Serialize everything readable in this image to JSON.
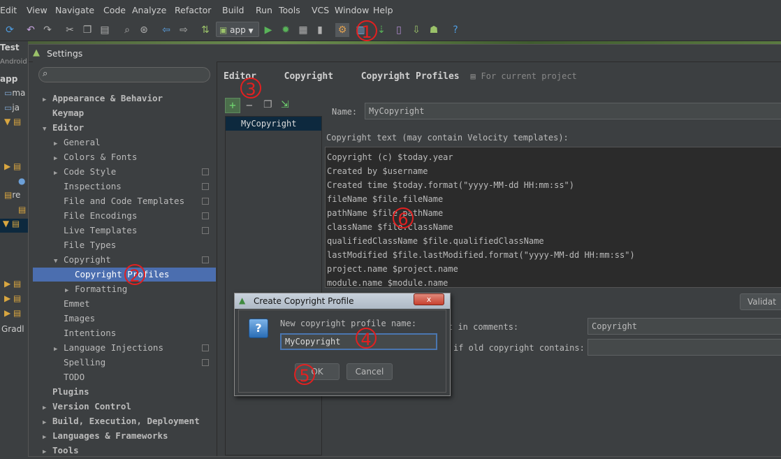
{
  "menubar": {
    "items": [
      "Edit",
      "View",
      "Navigate",
      "Code",
      "Analyze",
      "Refactor",
      "Build",
      "Run",
      "Tools",
      "VCS",
      "Window",
      "Help"
    ]
  },
  "toolbar": {
    "run_config": "app",
    "icons": [
      "sync-icon",
      "undo-icon",
      "redo-icon",
      "cut-icon",
      "copy-icon",
      "paste-icon",
      "find-icon",
      "replace-icon",
      "back-icon",
      "forward-icon",
      "build-icon",
      "android-icon",
      "run-icon",
      "debug-icon",
      "coverage-icon",
      "stop-icon",
      "settings-icon",
      "project-structure-icon",
      "sync-gradle-icon",
      "avd-icon",
      "sdk-icon",
      "android-monitor-icon",
      "help-icon"
    ]
  },
  "ide_left": {
    "tab": "Test",
    "rows": [
      "Android",
      "app",
      "ma",
      "ja",
      "re",
      "Gradl"
    ]
  },
  "settings": {
    "title": "Settings",
    "tree": [
      {
        "label": "Appearance & Behavior",
        "bold": true,
        "arrow": "right",
        "indent": 0
      },
      {
        "label": "Keymap",
        "bold": true,
        "arrow": "",
        "indent": 0
      },
      {
        "label": "Editor",
        "bold": true,
        "arrow": "down",
        "indent": 0
      },
      {
        "label": "General",
        "arrow": "right",
        "indent": 1
      },
      {
        "label": "Colors & Fonts",
        "arrow": "right",
        "indent": 1
      },
      {
        "label": "Code Style",
        "arrow": "right",
        "indent": 1,
        "copy": true
      },
      {
        "label": "Inspections",
        "arrow": "",
        "indent": 1,
        "copy": true
      },
      {
        "label": "File and Code Templates",
        "arrow": "",
        "indent": 1,
        "copy": true
      },
      {
        "label": "File Encodings",
        "arrow": "",
        "indent": 1,
        "copy": true
      },
      {
        "label": "Live Templates",
        "arrow": "",
        "indent": 1,
        "copy": true
      },
      {
        "label": "File Types",
        "arrow": "",
        "indent": 1
      },
      {
        "label": "Copyright",
        "arrow": "down",
        "indent": 1,
        "copy": true
      },
      {
        "label": "Copyright Profiles",
        "arrow": "",
        "indent": 2,
        "selected": true
      },
      {
        "label": "Formatting",
        "arrow": "right",
        "indent": 2
      },
      {
        "label": "Emmet",
        "arrow": "",
        "indent": 1
      },
      {
        "label": "Images",
        "arrow": "",
        "indent": 1
      },
      {
        "label": "Intentions",
        "arrow": "",
        "indent": 1
      },
      {
        "label": "Language Injections",
        "arrow": "right",
        "indent": 1,
        "copy": true
      },
      {
        "label": "Spelling",
        "arrow": "",
        "indent": 1,
        "copy": true
      },
      {
        "label": "TODO",
        "arrow": "",
        "indent": 1
      },
      {
        "label": "Plugins",
        "bold": true,
        "arrow": "",
        "indent": 0
      },
      {
        "label": "Version Control",
        "bold": true,
        "arrow": "right",
        "indent": 0
      },
      {
        "label": "Build, Execution, Deployment",
        "bold": true,
        "arrow": "right",
        "indent": 0
      },
      {
        "label": "Languages & Frameworks",
        "bold": true,
        "arrow": "right",
        "indent": 0
      },
      {
        "label": "Tools",
        "bold": true,
        "arrow": "right",
        "indent": 0
      }
    ],
    "breadcrumb": [
      "Editor",
      "Copyright",
      "Copyright Profiles"
    ],
    "for_current_project": "For current project",
    "profiles": [
      "MyCopyright"
    ],
    "name_label": "Name:",
    "name_value": "MyCopyright",
    "copyright_text_label": "Copyright text (may contain Velocity templates):",
    "copyright_lines": [
      "Copyright (c) $today.year",
      "Created by $username",
      "Created time $today.format(\"yyyy-MM-dd HH:mm:ss\")",
      "fileName $file.fileName",
      "pathName $file.pathName",
      "className $file.className",
      "qualifiedClassName $file.qualifiedClassName",
      "lastModified $file.lastModified.format(\"yyyy-MM-dd HH:mm:ss\")",
      "project.name $project.name",
      "module.name $module.name"
    ],
    "validate_button": "Validat",
    "keyword_label": "t in comments:",
    "keyword_value": "Copyright",
    "replace_label": "if old copyright contains:",
    "replace_value": ""
  },
  "modal": {
    "title": "Create Copyright Profile",
    "close": "x",
    "prompt": "New copyright profile name:",
    "input_value": "MyCopyright",
    "ok": "OK",
    "cancel": "Cancel"
  },
  "annotations": [
    "1",
    "2",
    "3",
    "4",
    "5",
    "6"
  ],
  "colors": {
    "accent": "#4b6eaf",
    "annotation": "#e22020",
    "plus_green": "#5fb35f"
  }
}
